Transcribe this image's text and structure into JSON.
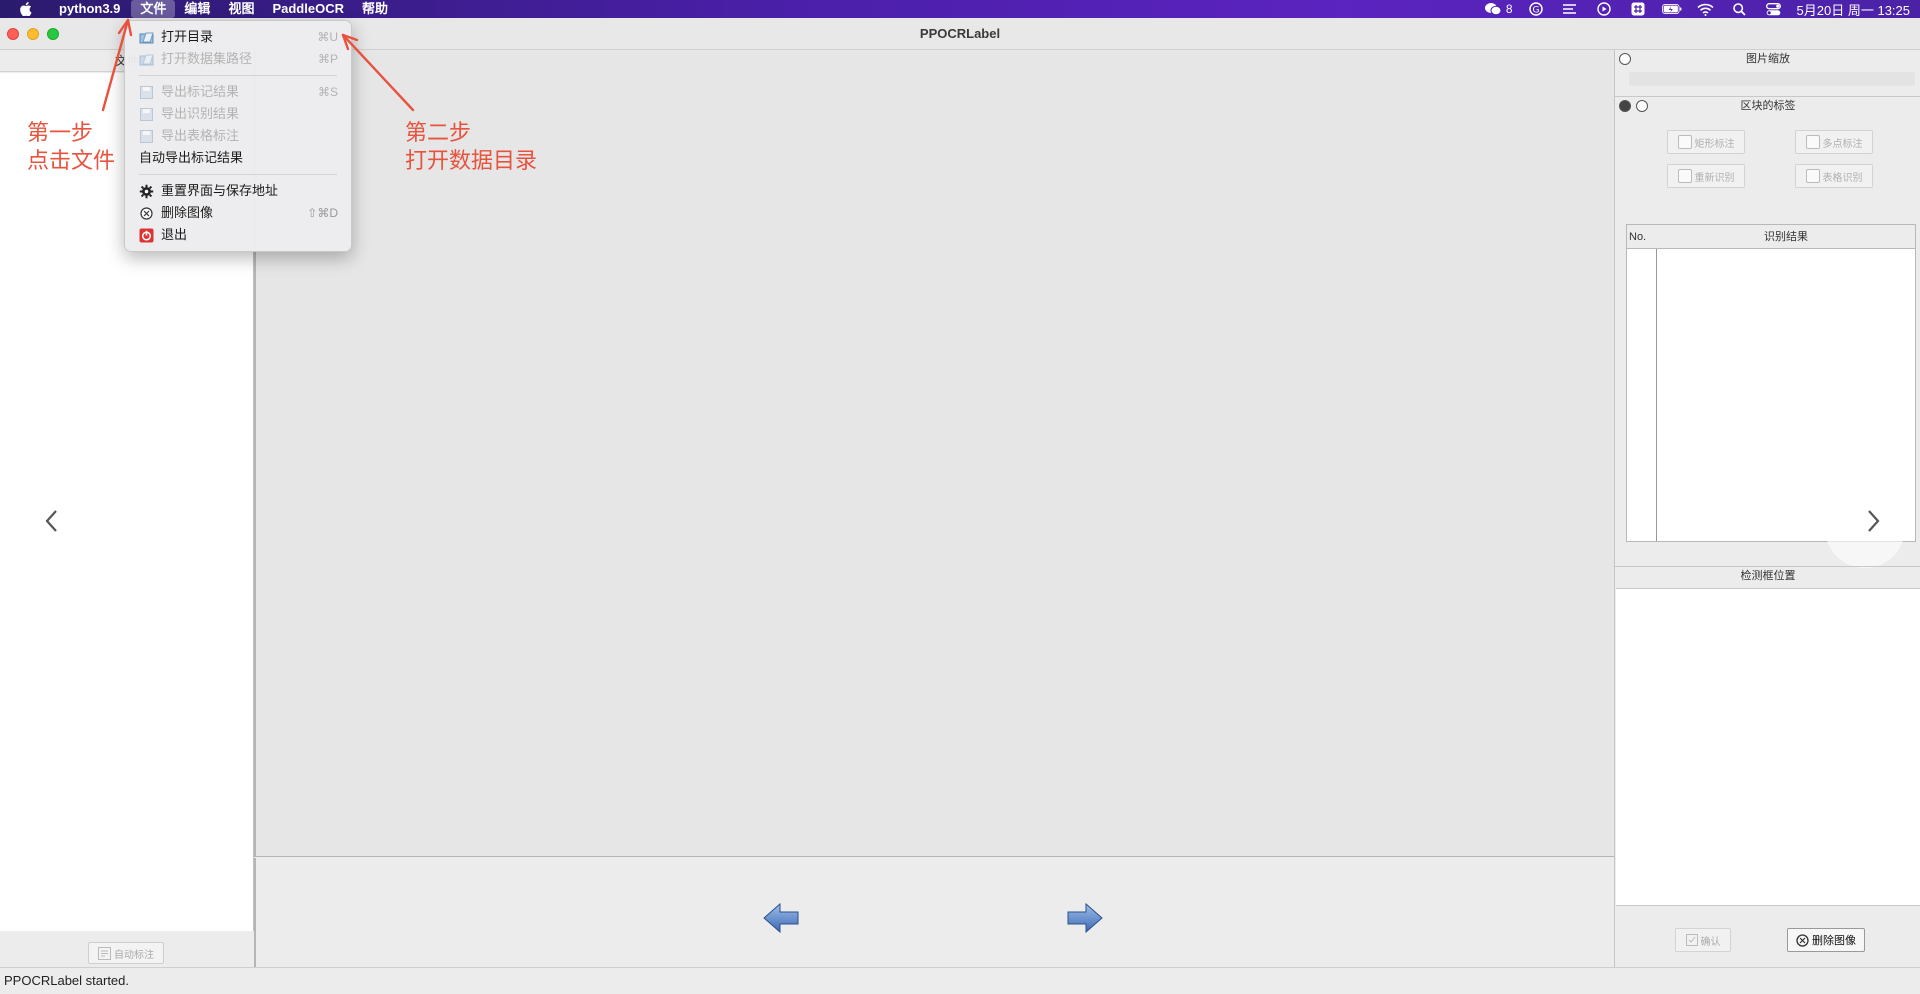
{
  "menubar": {
    "app_name": "python3.9",
    "menus": [
      "文件",
      "编辑",
      "视图",
      "PaddleOCR",
      "帮助"
    ],
    "active_menu": "文件",
    "wechat_count": "8",
    "clock": "5月20日 周一  13:25",
    "status_icons": [
      "wechat-icon",
      "vpn-icon",
      "notes-icon",
      "play-icon",
      "input-method-icon",
      "battery-icon",
      "wifi-icon",
      "search-icon",
      "control-center-icon"
    ]
  },
  "window": {
    "title": "PPOCRLabel"
  },
  "left_panel": {
    "header": "文件",
    "auto_label_button": "自动标注"
  },
  "file_menu": {
    "items": [
      {
        "label": "打开目录",
        "shortcut": "⌘U",
        "enabled": true,
        "icon": "open-folder-icon"
      },
      {
        "label": "打开数据集路径",
        "shortcut": "⌘P",
        "enabled": false,
        "icon": "open-folder-icon"
      },
      {
        "label": "导出标记结果",
        "shortcut": "⌘S",
        "enabled": false,
        "icon": "save-icon"
      },
      {
        "label": "导出识别结果",
        "shortcut": "",
        "enabled": false,
        "icon": "save-icon"
      },
      {
        "label": "导出表格标注",
        "shortcut": "",
        "enabled": false,
        "icon": "save-icon"
      },
      {
        "label": "自动导出标记结果",
        "shortcut": "",
        "enabled": true,
        "icon": ""
      },
      {
        "label": "重置界面与保存地址",
        "shortcut": "",
        "enabled": true,
        "icon": "gear-icon"
      },
      {
        "label": "删除图像",
        "shortcut": "⇧⌘D",
        "enabled": true,
        "icon": "delete-icon"
      },
      {
        "label": "退出",
        "shortcut": "",
        "enabled": true,
        "icon": "quit-icon"
      }
    ]
  },
  "right_panel": {
    "zoom_header": "图片缩放",
    "labels_header": "区块的标签",
    "tools": [
      "矩形标注",
      "多点标注",
      "重新识别",
      "表格识别"
    ],
    "result_columns": [
      "No.",
      "识别结果"
    ],
    "bbox_header": "检测框位置",
    "confirm_button": "确认",
    "delete_button": "删除图像"
  },
  "status": {
    "message": "PPOCRLabel started."
  },
  "annotations": {
    "step1_line1": "第一步",
    "step1_line2": "点击文件",
    "step2_line1": "第二步",
    "step2_line2": "打开数据目录"
  },
  "colors": {
    "annotation": "#e8533e",
    "menubar": "#4a1fa8"
  }
}
